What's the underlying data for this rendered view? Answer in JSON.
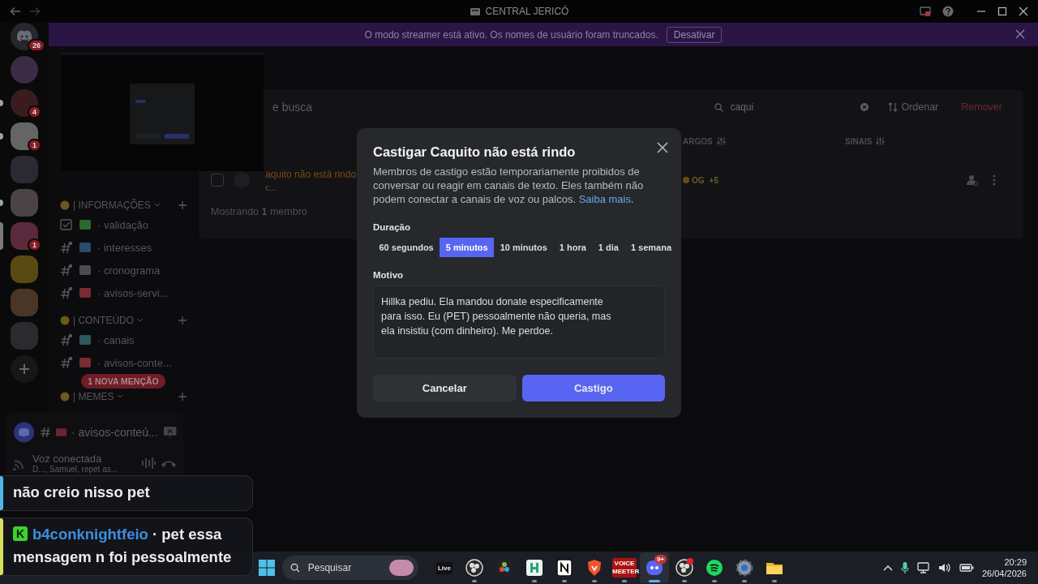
{
  "window": {
    "title": "CENTRAL JERICÓ"
  },
  "streamer_banner": {
    "text": "O modo streamer está ativo. Os nomes de usuário foram truncados.",
    "button": "Desativar"
  },
  "server_rail": [
    {
      "kind": "home",
      "badge": "26",
      "unread": false,
      "selected": false
    },
    {
      "kind": "folder",
      "unread": false,
      "selected": false
    },
    {
      "kind": "server",
      "badge": "4",
      "unread": true,
      "selected": false
    },
    {
      "kind": "server",
      "badge": "1",
      "unread": true,
      "selected": false
    },
    {
      "kind": "server",
      "unread": false,
      "selected": false
    },
    {
      "kind": "folder",
      "unread": true,
      "selected": false
    },
    {
      "kind": "server",
      "badge": "1",
      "unread": false,
      "selected": true
    },
    {
      "kind": "server",
      "unread": false,
      "selected": false
    },
    {
      "kind": "server",
      "unread": false,
      "selected": false
    },
    {
      "kind": "server",
      "unread": false,
      "selected": false
    },
    {
      "kind": "add",
      "unread": false,
      "selected": false
    }
  ],
  "channel_list": {
    "categories": [
      {
        "name": "| INFORMAÇÕES",
        "channels": [
          {
            "name": "· validação",
            "kind": "rules"
          },
          {
            "name": "· interesses",
            "kind": "text"
          },
          {
            "name": "· cronograma",
            "kind": "text"
          },
          {
            "name": "· avisos-servi...",
            "kind": "text"
          }
        ]
      },
      {
        "name": "| CONTEÚDO",
        "channels": [
          {
            "name": "· canais",
            "kind": "text"
          },
          {
            "name": "· avisos-conte...",
            "kind": "text"
          }
        ]
      },
      {
        "name": "| MEMES"
      }
    ],
    "mention_pill": "1 NOVA MENÇÃO"
  },
  "voice_panel": {
    "channel": "· avisos-conteú...",
    "status": "Voz conectada",
    "members": "D..., Samuel, repet as..."
  },
  "member_panel": {
    "heading": "e busca",
    "search": {
      "value": "caqui"
    },
    "sort_button": "Ordenar",
    "remove_button": "Remover",
    "columns": [
      "ARGOS",
      "SINAIS"
    ],
    "rows": [
      {
        "name": "aquito não está rindo",
        "subtitle": "c...",
        "role": "OG",
        "more_roles": "+5",
        "selected": false
      }
    ],
    "footer": "Mostrando **1** membro"
  },
  "modal": {
    "title": "Castigar Caquito não está rindo",
    "description": "Membros de castigo estão temporariamente proibidos de conversar ou reagir em canais de texto. Eles também não podem conectar a canais de voz ou palcos.",
    "link": "Saiba mais",
    "link_suffix": ".",
    "duration_label": "Duração",
    "durations": [
      {
        "label": "60 segundos",
        "selected": false
      },
      {
        "label": "5 minutos",
        "selected": true
      },
      {
        "label": "10 minutos",
        "selected": false
      },
      {
        "label": "1 hora",
        "selected": false
      },
      {
        "label": "1 dia",
        "selected": false
      },
      {
        "label": "1 semana",
        "selected": false
      }
    ],
    "reason_label": "Motivo",
    "reason": "Hillka pediu. Ela mandou donate especificamente para isso. Eu (PET) pessoalmente não queria, mas ela insistiu (com dinheiro). Me perdoe.",
    "cancel": "Cancelar",
    "confirm": "Castigo"
  },
  "chat_overlay": {
    "messages": [
      {
        "text": "não creio nisso pet",
        "color": "#4fb8e8"
      },
      {
        "platform_badge": "K",
        "author": "b4conknightfeio",
        "text": "· pet essa mensagem n foi pessoalmente",
        "color": "#d6e05a"
      }
    ]
  },
  "taskbar": {
    "search_placeholder": "Pesquisar",
    "apps": [
      {
        "kind": "live",
        "label": "Live",
        "running": false,
        "active": false
      },
      {
        "kind": "obs",
        "running": true,
        "active": false
      },
      {
        "kind": "resolve",
        "running": false,
        "active": false
      },
      {
        "kind": "h",
        "running": true,
        "active": false
      },
      {
        "kind": "notion",
        "running": true,
        "active": false
      },
      {
        "kind": "brave",
        "running": true,
        "active": false
      },
      {
        "kind": "voicemeeter",
        "label": "VOICE MEETER",
        "running": true,
        "active": false
      },
      {
        "kind": "discord",
        "badge": "9+",
        "running": true,
        "active": true
      },
      {
        "kind": "obs",
        "notification": true,
        "running": true,
        "active": false
      },
      {
        "kind": "spotify",
        "running": true,
        "active": false
      },
      {
        "kind": "settings",
        "running": true,
        "active": false
      },
      {
        "kind": "files",
        "running": true,
        "active": false
      }
    ],
    "clock": {
      "time": "20:29",
      "date": "26/04/2026"
    }
  }
}
